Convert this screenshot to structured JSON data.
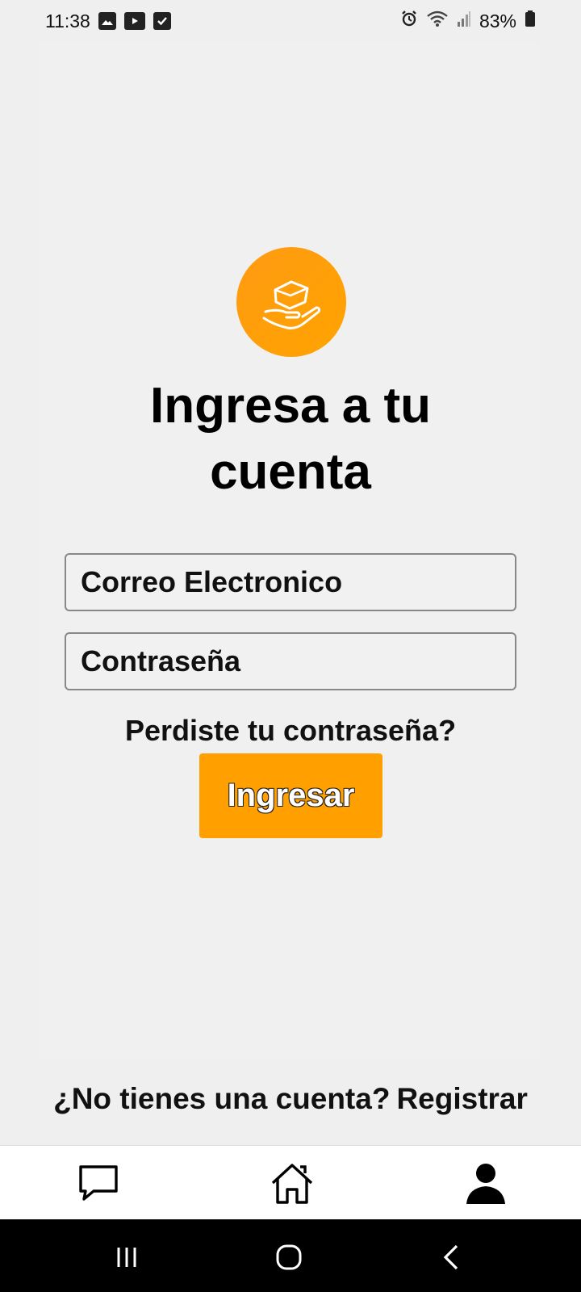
{
  "status_bar": {
    "time": "11:38",
    "battery": "83%",
    "left_icons": [
      "gallery-icon",
      "youtube-icon",
      "checkbox-icon"
    ],
    "right_icons": [
      "alarm-icon",
      "wifi-icon",
      "signal-icon",
      "battery-icon"
    ]
  },
  "login": {
    "title": "Ingresa a tu cuenta",
    "email_placeholder": "Correo Electronico",
    "password_placeholder": "Contraseña",
    "forgot_label": "Perdiste tu contraseña?",
    "submit_label": "Ingresar",
    "register_prompt": "¿No tienes una cuenta?",
    "register_link": "Registrar"
  },
  "bottom_nav": {
    "items": [
      "chat-icon",
      "home-icon",
      "profile-icon"
    ]
  },
  "colors": {
    "accent": "#ffa000",
    "background": "#efefef"
  }
}
